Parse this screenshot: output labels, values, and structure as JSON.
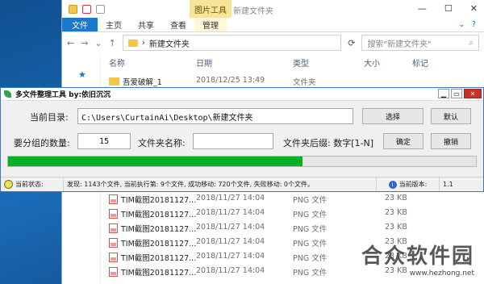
{
  "explorer": {
    "tools_tab": "图片工具",
    "window_title": "新建文件夹",
    "ribbon": {
      "file": "文件",
      "home": "主页",
      "share": "共享",
      "view": "查看",
      "manage": "管理"
    },
    "address": "新建文件夹",
    "search_placeholder": "搜索\"新建文件夹\"",
    "columns": {
      "name": "名称",
      "date": "日期",
      "type": "类型",
      "size": "大小",
      "tags": "标记"
    },
    "top_row": {
      "name": "吾爱破解_1",
      "date": "2018/12/25 13:49",
      "type": "文件夹"
    },
    "rows": [
      {
        "name": "TIM截图20181127...",
        "date": "2018/11/27 14:04",
        "type": "PNG 文件",
        "size": "23 KB"
      },
      {
        "name": "TIM截图20181127...",
        "date": "2018/11/27 14:04",
        "type": "PNG 文件",
        "size": "23 KB"
      },
      {
        "name": "TIM截图20181127...",
        "date": "2018/11/27 14:04",
        "type": "PNG 文件",
        "size": "23 KB"
      },
      {
        "name": "TIM截图20181127...",
        "date": "2018/11/27 14:04",
        "type": "PNG 文件",
        "size": "23 KB"
      },
      {
        "name": "TIM截图20181127...",
        "date": "2018/11/27 14:04",
        "type": "PNG 文件",
        "size": "23 KB"
      },
      {
        "name": "TIM截图20181127...",
        "date": "2018/11/27 14:04",
        "type": "PNG 文件",
        "size": "23 KB"
      }
    ]
  },
  "tool": {
    "title": "多文件整理工具 by:依旧沉沉",
    "current_dir_label": "当前目录:",
    "current_dir": "C:\\Users\\CurtainAi\\Desktop\\新建文件夹",
    "select_btn": "选择",
    "default_btn": "默认",
    "group_count_label": "要分组的数量:",
    "group_count": "15",
    "folder_name_label": "文件夹名称:",
    "folder_name": "",
    "suffix_label": "文件夹后缀: 数字[1-N]",
    "confirm_btn": "确定",
    "cancel_btn": "撤销",
    "progress": 0.63,
    "status_label": "当前状态:",
    "status_text": "发现: 1143个文件, 当前执行第: 9个文件, 成功移动: 720个文件, 失败移动: 0个文件。",
    "version_label": "当前版本:",
    "version": "1.1"
  },
  "watermark": {
    "text": "合众软件园",
    "url": "www.hezhong.net"
  },
  "colors": {
    "accent": "#1979ca",
    "progress_fill": "#06b025",
    "close": "#c9302c"
  }
}
